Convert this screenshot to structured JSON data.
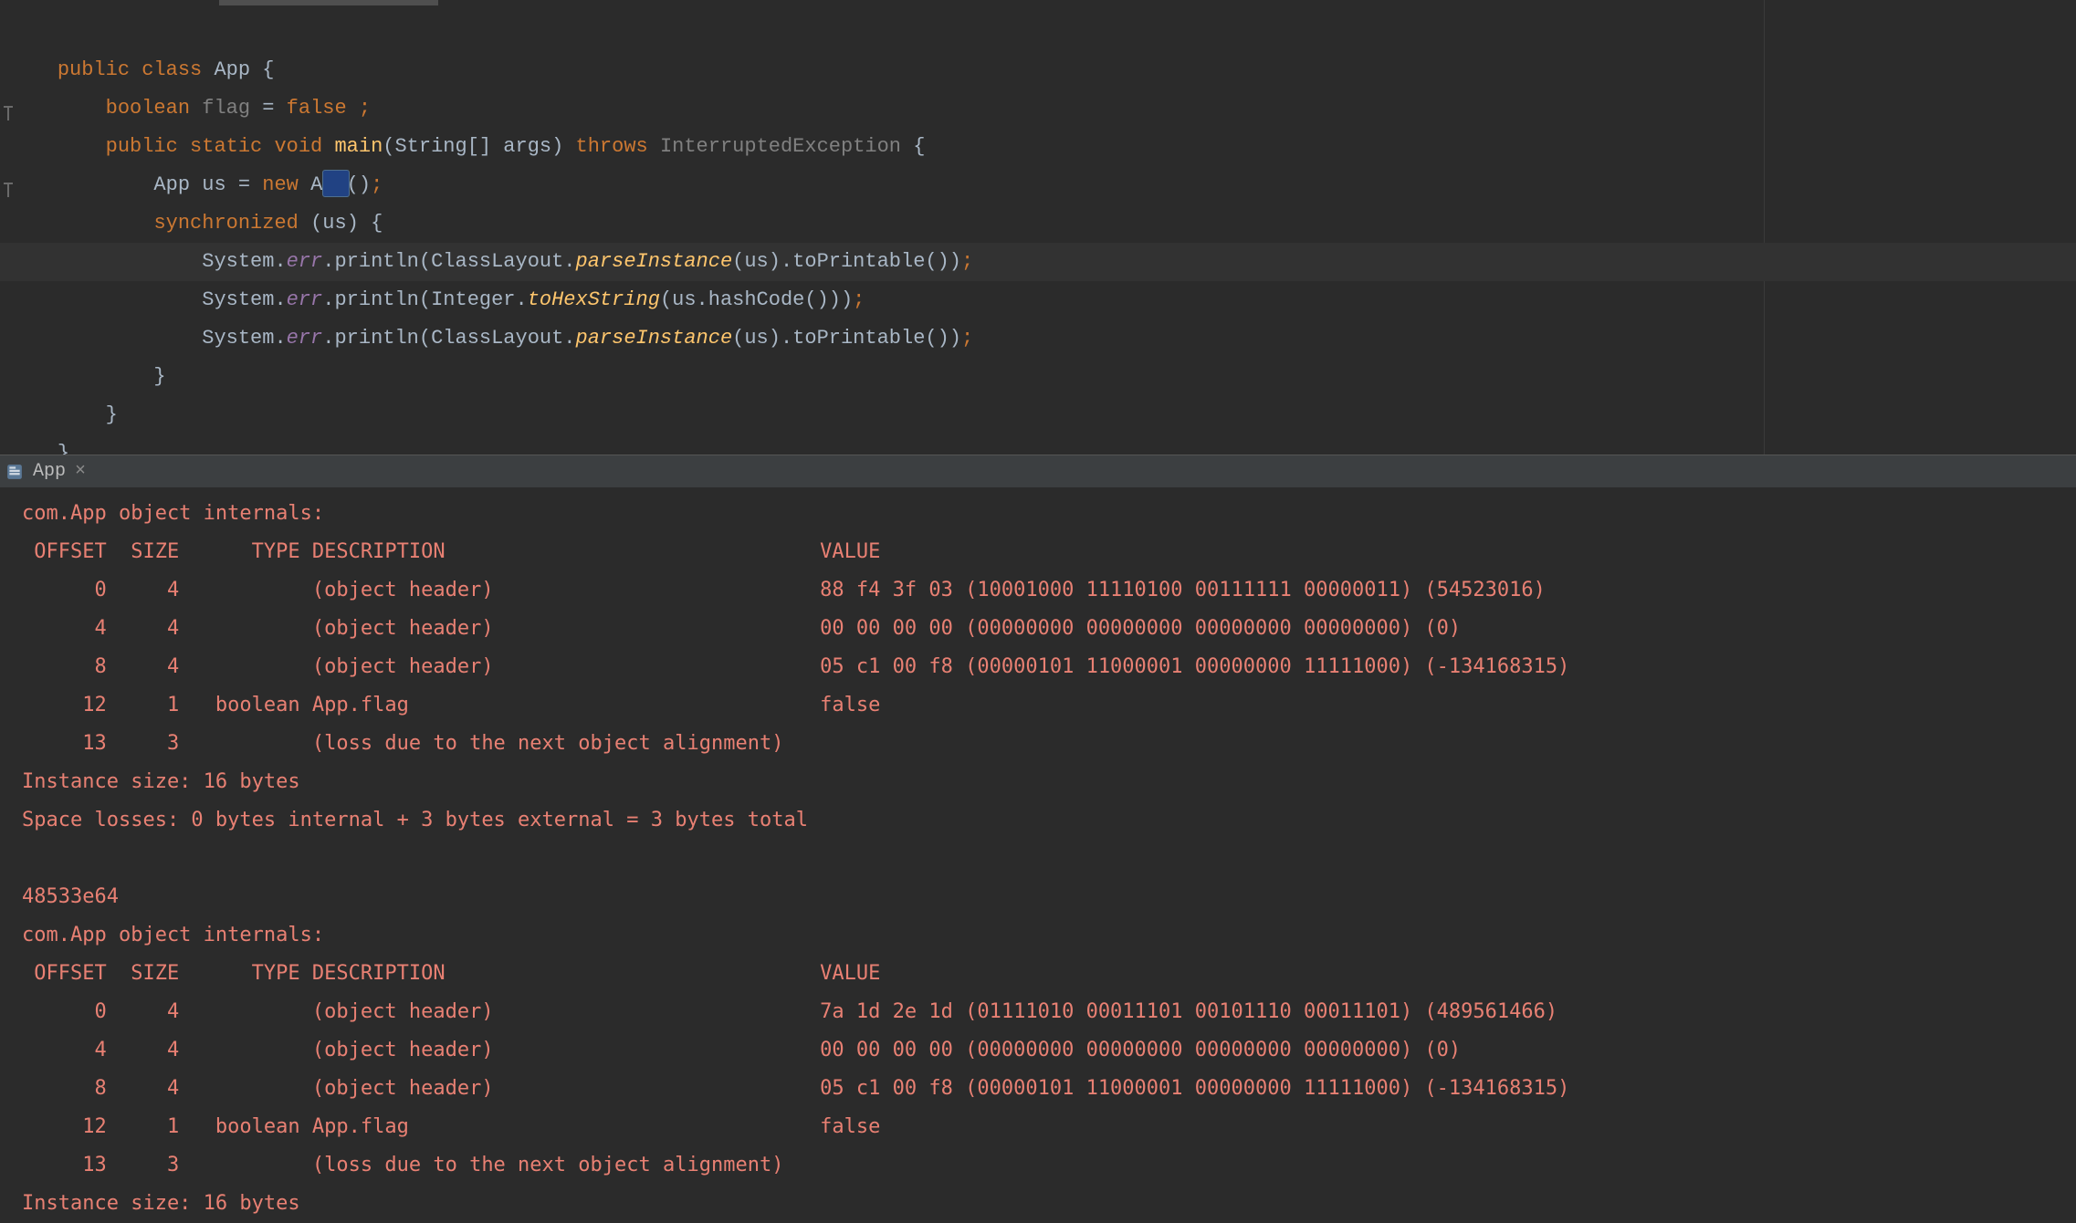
{
  "tab": {
    "label": "App",
    "close": "×"
  },
  "code": {
    "l1": {
      "a": "public class ",
      "b": "App ",
      "c": "{"
    },
    "l2": {
      "a": "    ",
      "b": "boolean ",
      "c": "flag ",
      "d": "= ",
      "e": "false ",
      "f": ";"
    },
    "l3": {
      "a": "    ",
      "b": "public static void ",
      "c": "main",
      "d": "(",
      "e": "String",
      "f": "[] args) ",
      "g": "throws ",
      "h": "InterruptedException ",
      "i": "{"
    },
    "l4": {
      "a": "        App us = ",
      "b": "new ",
      "c": "App()",
      "d": ";"
    },
    "l5": {
      "a": "        ",
      "b": "synchronized ",
      "c": "(",
      "d": "us",
      "e": ") {"
    },
    "l6": {
      "a": "            System.",
      "b": "err",
      "c": ".println(ClassLayout.",
      "d": "parseInstance",
      "e": "(us).toPrintable())",
      "f": ";"
    },
    "l7": {
      "a": "            System.",
      "b": "err",
      "c": ".println(Integer.",
      "d": "toHexString",
      "e": "(us.hashCode()))",
      "f": ";"
    },
    "l8": {
      "a": "            System.",
      "b": "err",
      "c": ".println(ClassLayout.",
      "d": "parseInstance",
      "e": "(us).toPrintable())",
      "f": ";"
    },
    "l9": {
      "a": "        }"
    },
    "l10": {
      "a": "    }"
    },
    "l11": {
      "a": "}"
    }
  },
  "console": {
    "lines": [
      "com.App object internals:",
      " OFFSET  SIZE      TYPE DESCRIPTION                               VALUE",
      "      0     4           (object header)                           88 f4 3f 03 (10001000 11110100 00111111 00000011) (54523016)",
      "      4     4           (object header)                           00 00 00 00 (00000000 00000000 00000000 00000000) (0)",
      "      8     4           (object header)                           05 c1 00 f8 (00000101 11000001 00000000 11111000) (-134168315)",
      "     12     1   boolean App.flag                                  false",
      "     13     3           (loss due to the next object alignment)",
      "Instance size: 16 bytes",
      "Space losses: 0 bytes internal + 3 bytes external = 3 bytes total",
      "",
      "48533e64",
      "com.App object internals:",
      " OFFSET  SIZE      TYPE DESCRIPTION                               VALUE",
      "      0     4           (object header)                           7a 1d 2e 1d (01111010 00011101 00101110 00011101) (489561466)",
      "      4     4           (object header)                           00 00 00 00 (00000000 00000000 00000000 00000000) (0)",
      "      8     4           (object header)                           05 c1 00 f8 (00000101 11000001 00000000 11111000) (-134168315)",
      "     12     1   boolean App.flag                                  false",
      "     13     3           (loss due to the next object alignment)",
      "Instance size: 16 bytes"
    ]
  }
}
